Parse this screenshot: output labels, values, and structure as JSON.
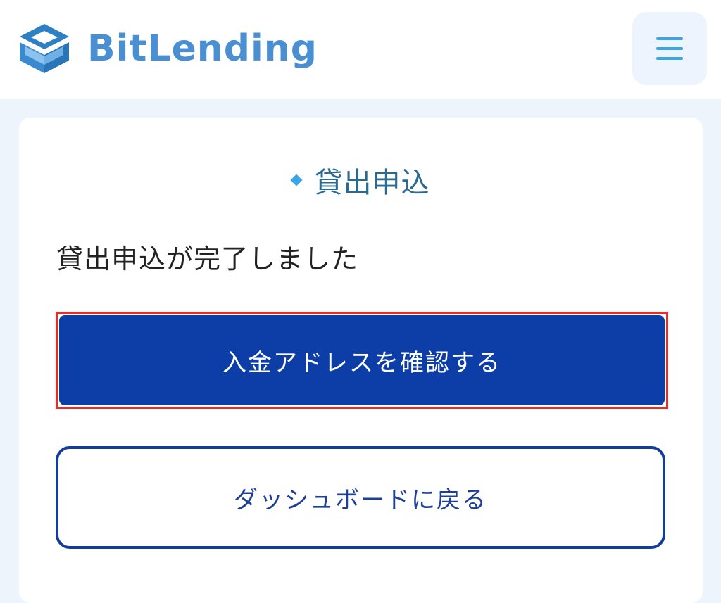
{
  "header": {
    "logo_text": "BitLending",
    "menu_icon": "hamburger-menu-icon"
  },
  "main": {
    "section_title": "貸出申込",
    "completion_message": "貸出申込が完了しました",
    "confirm_address_button": "入金アドレスを確認する",
    "back_to_dashboard_button": "ダッシュボードに戻る"
  },
  "colors": {
    "brand_blue": "#4a8fd1",
    "primary_button": "#0d3ea8",
    "highlight_frame": "#e52e28",
    "page_background": "#eef4fb"
  }
}
